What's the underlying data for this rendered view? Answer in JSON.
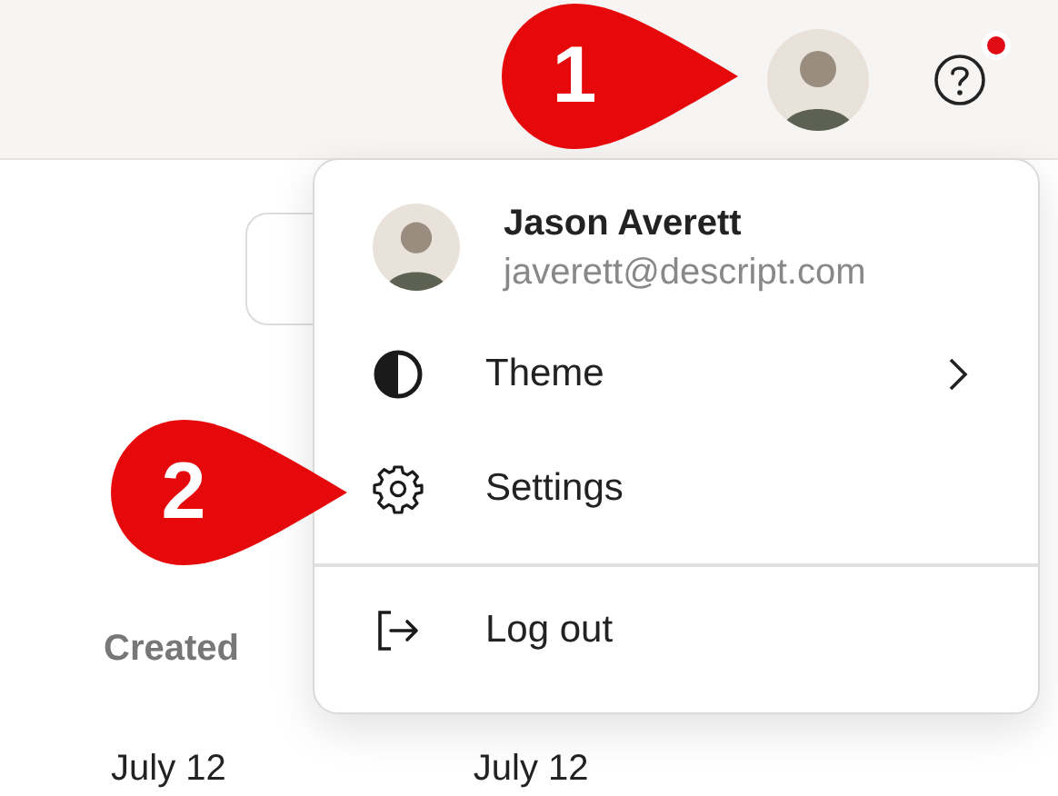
{
  "topbar": {
    "help_notification": true
  },
  "toolbar": {
    "kind": "button"
  },
  "table": {
    "columns": [
      "Created"
    ],
    "rows": [
      [
        "July 12",
        "July 12"
      ]
    ]
  },
  "account_menu": {
    "name": "Jason Averett",
    "email": "javerett@descript.com",
    "items": [
      {
        "label": "Theme",
        "kind": "submenu",
        "separated": false
      },
      {
        "label": "Settings",
        "kind": "action",
        "separated": false
      },
      {
        "label": "Log out",
        "kind": "action",
        "separated": true
      }
    ]
  },
  "callouts": [
    {
      "number": "1"
    },
    {
      "number": "2"
    }
  ]
}
